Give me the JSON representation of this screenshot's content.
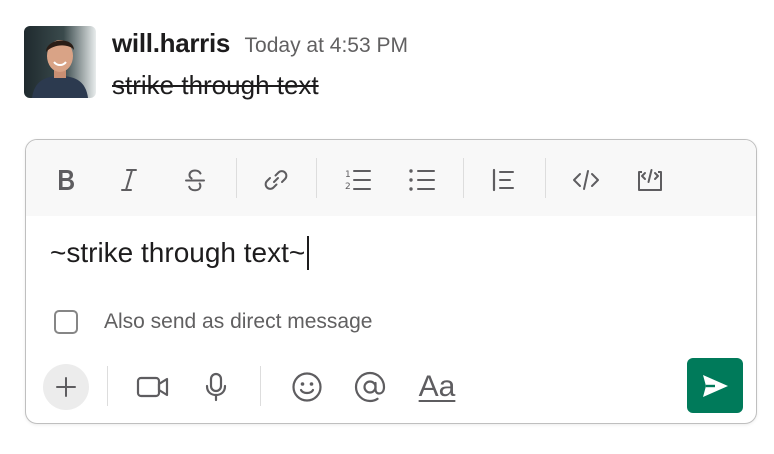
{
  "message": {
    "author": "will.harris",
    "timestamp": "Today at 4:53 PM",
    "text": "strike through text"
  },
  "composer": {
    "toolbar": {
      "icons": [
        "bold-icon",
        "italic-icon",
        "strikethrough-icon",
        "link-icon",
        "ordered-list-icon",
        "bulleted-list-icon",
        "blockquote-icon",
        "code-icon",
        "code-block-icon"
      ]
    },
    "input_value": "~strike through text~",
    "dm_checkbox": {
      "label": "Also send as direct message",
      "checked": false
    },
    "bottom_bar": {
      "icons": [
        "plus-icon",
        "video-icon",
        "microphone-icon",
        "emoji-icon",
        "mention-icon",
        "formatting-icon"
      ],
      "formatting_label": "Aa"
    },
    "send_button_color": "#007a5a"
  }
}
